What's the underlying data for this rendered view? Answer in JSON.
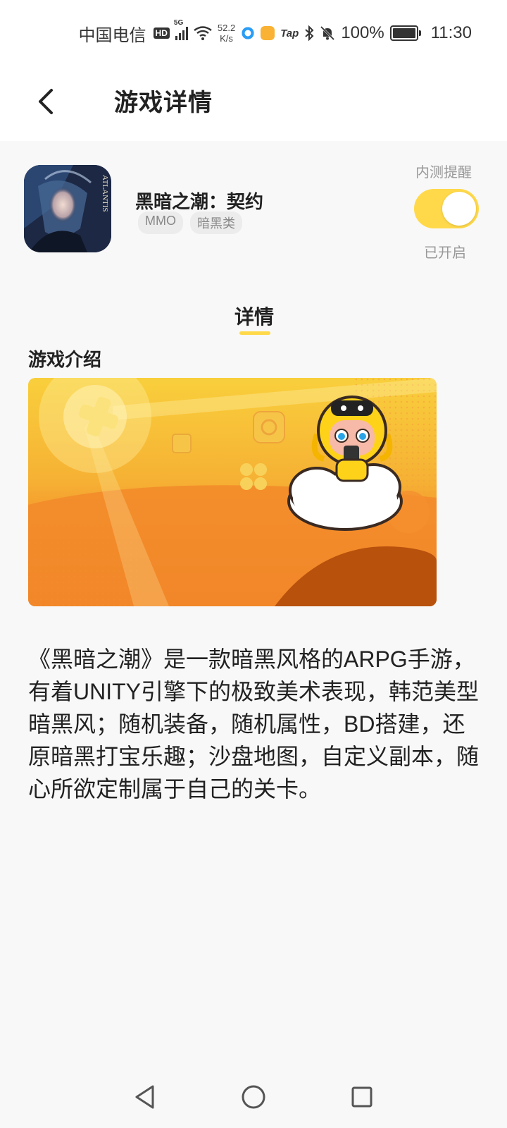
{
  "status_bar": {
    "carrier": "中国电信",
    "hd": "HD",
    "network": "5G",
    "speed_value": "52.2",
    "speed_unit": "K/s",
    "tap_label": "Tap",
    "battery": "100%",
    "time": "11:30"
  },
  "header": {
    "title": "游戏详情"
  },
  "game": {
    "name": "黑暗之潮：契约",
    "icon_text": "ATLANTIS",
    "tags": [
      "MMO",
      "暗黑类"
    ],
    "reminder_label": "内测提醒",
    "reminder_state": "已开启",
    "reminder_on": true
  },
  "tabs": [
    {
      "label": "详情",
      "active": true
    }
  ],
  "section": {
    "title": "游戏介绍"
  },
  "description": "《黑暗之潮》是一款暗黑风格的ARPG手游，有着UNITY引擎下的极致美术表现，韩范美型暗黑风；随机装备，随机属性，BD搭建，还原暗黑打宝乐趣；沙盘地图，自定义副本，随心所欲定制属于自己的关卡。",
  "colors": {
    "accent": "#ffd94a",
    "banner_top": "#f8c63a",
    "banner_bottom": "#f07a22"
  }
}
